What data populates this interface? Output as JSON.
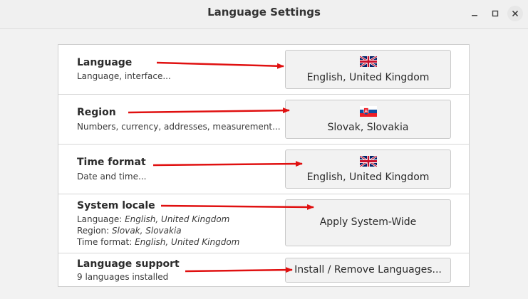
{
  "window": {
    "title": "Language Settings"
  },
  "rows": {
    "language": {
      "title": "Language",
      "subtitle": "Language, interface...",
      "button": "English, United Kingdom",
      "flag": "uk-flag-icon"
    },
    "region": {
      "title": "Region",
      "subtitle": "Numbers, currency, addresses, measurement...",
      "button": "Slovak, Slovakia",
      "flag": "slovakia-flag-icon"
    },
    "time_format": {
      "title": "Time format",
      "subtitle": "Date and time...",
      "button": "English, United Kingdom",
      "flag": "uk-flag-icon"
    },
    "system_locale": {
      "title": "System locale",
      "language_label": "Language: ",
      "language_value": "English, United Kingdom",
      "region_label": "Region: ",
      "region_value": "Slovak, Slovakia",
      "time_label": "Time format: ",
      "time_value": "English, United Kingdom",
      "button": "Apply System-Wide"
    },
    "language_support": {
      "title": "Language support",
      "subtitle": "9 languages installed",
      "button": "Install / Remove Languages..."
    }
  },
  "colors": {
    "annotation_arrow": "#e01010"
  }
}
